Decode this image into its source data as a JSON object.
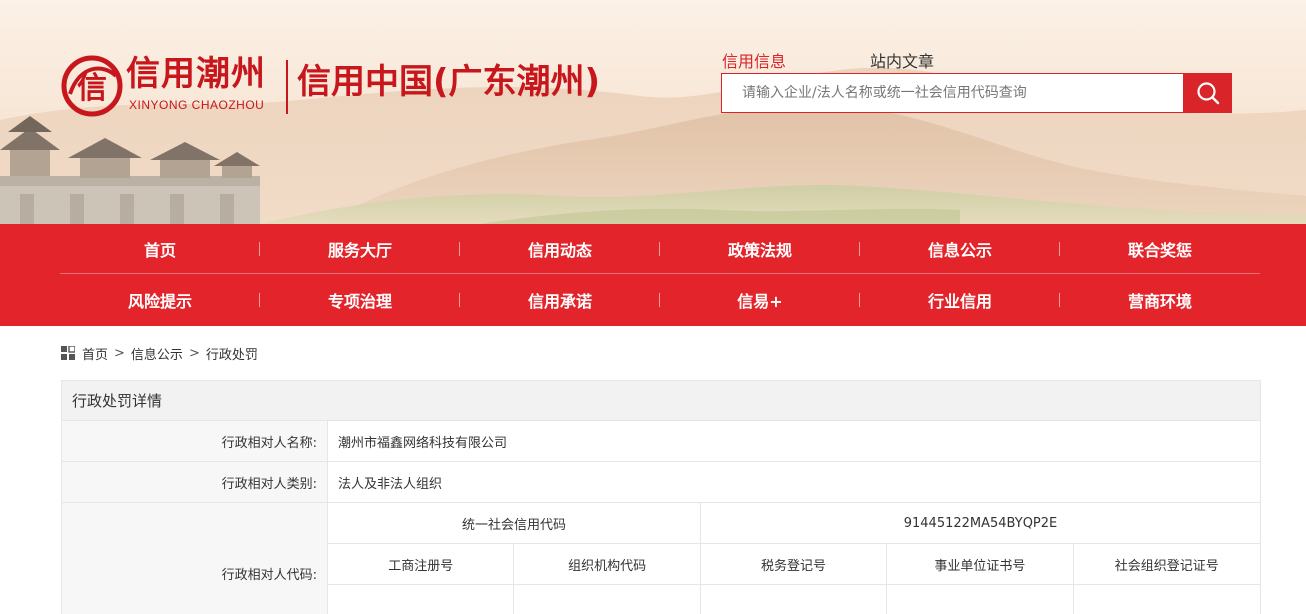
{
  "colors": {
    "brand_red": "#d9242a",
    "nav_red": "#e3242b",
    "logo_red": "#c8161d"
  },
  "logo": {
    "cn": "信用潮州",
    "en": "XINYONG CHAOZHOU",
    "site_title": "信用中国(广东潮州)",
    "emblem_icon": "credit-seal-icon"
  },
  "search": {
    "tabs": [
      {
        "label": "信用信息",
        "active": true
      },
      {
        "label": "站内文章",
        "active": false
      }
    ],
    "placeholder": "请输入企业/法人名称或统一社会信用代码查询",
    "value": "",
    "button_icon": "search-icon"
  },
  "nav": {
    "row1": [
      "首页",
      "服务大厅",
      "信用动态",
      "政策法规",
      "信息公示",
      "联合奖惩"
    ],
    "row2": [
      "风险提示",
      "专项治理",
      "信用承诺",
      "信易+",
      "行业信用",
      "营商环境"
    ]
  },
  "breadcrumb": {
    "icon": "grid-icon",
    "items": [
      "首页",
      "信息公示",
      "行政处罚"
    ],
    "separator": ">"
  },
  "detail": {
    "title": "行政处罚详情",
    "rows": [
      {
        "label": "行政相对人名称:",
        "value": "潮州市福鑫网络科技有限公司"
      },
      {
        "label": "行政相对人类别:",
        "value": "法人及非法人组织"
      }
    ],
    "code": {
      "label": "行政相对人代码:",
      "uscc_label": "统一社会信用代码",
      "uscc_value": "91445122MA54BYQP2E",
      "sub_headers": [
        "工商注册号",
        "组织机构代码",
        "税务登记号",
        "事业单位证书号",
        "社会组织登记证号"
      ],
      "sub_values": [
        "",
        "",
        "",
        "",
        ""
      ]
    }
  }
}
